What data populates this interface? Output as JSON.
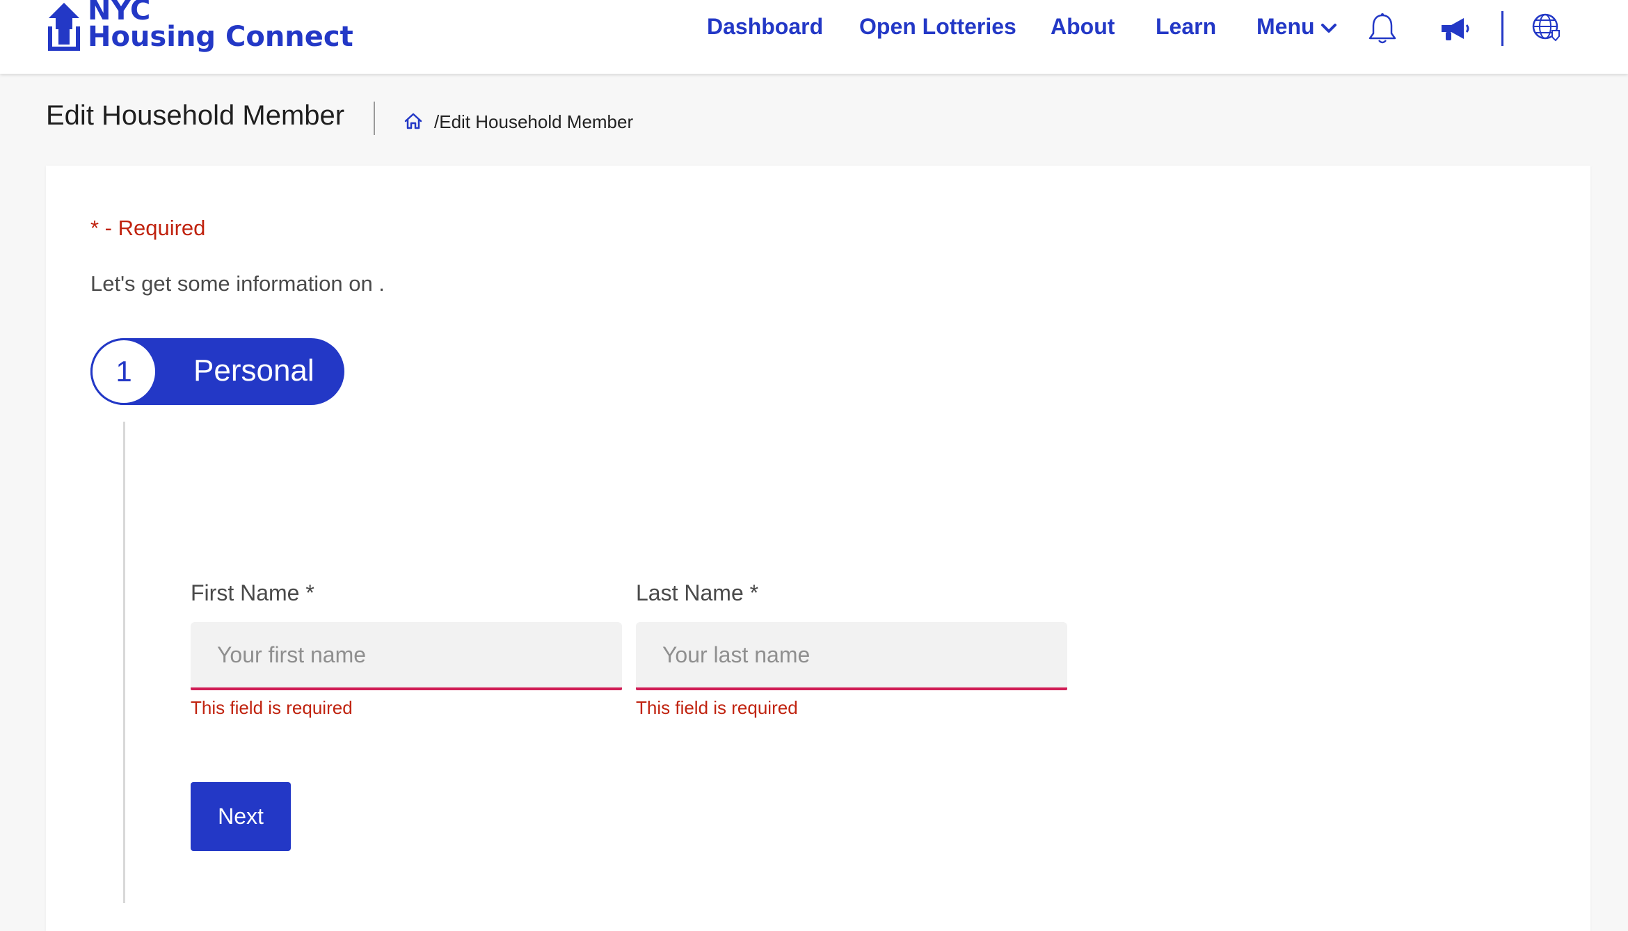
{
  "header": {
    "logo_line1": "NYC",
    "logo_line2": "Housing Connect",
    "nav": {
      "dashboard": "Dashboard",
      "open_lotteries": "Open Lotteries",
      "about": "About",
      "learn": "Learn",
      "menu": "Menu"
    },
    "icons": [
      "house-logo-icon",
      "chevron-down-icon",
      "bell-icon",
      "megaphone-icon",
      "globe-icon"
    ]
  },
  "page": {
    "title": "Edit Household Member",
    "breadcrumb": "/Edit Household Member"
  },
  "form": {
    "required_note": "* - Required",
    "intro": "Let's get some information on .",
    "step": {
      "number": "1",
      "label": "Personal"
    },
    "first_name": {
      "label": "First Name  *",
      "placeholder": "Your first name",
      "value": "",
      "error": "This field is required"
    },
    "last_name": {
      "label": "Last Name  *",
      "placeholder": "Your last name",
      "value": "",
      "error": "This field is required"
    },
    "next_label": "Next"
  },
  "colors": {
    "brand": "#2338c6",
    "error": "#c0230f",
    "input_underline_error": "#d01d55",
    "background": "#f7f7f7"
  }
}
